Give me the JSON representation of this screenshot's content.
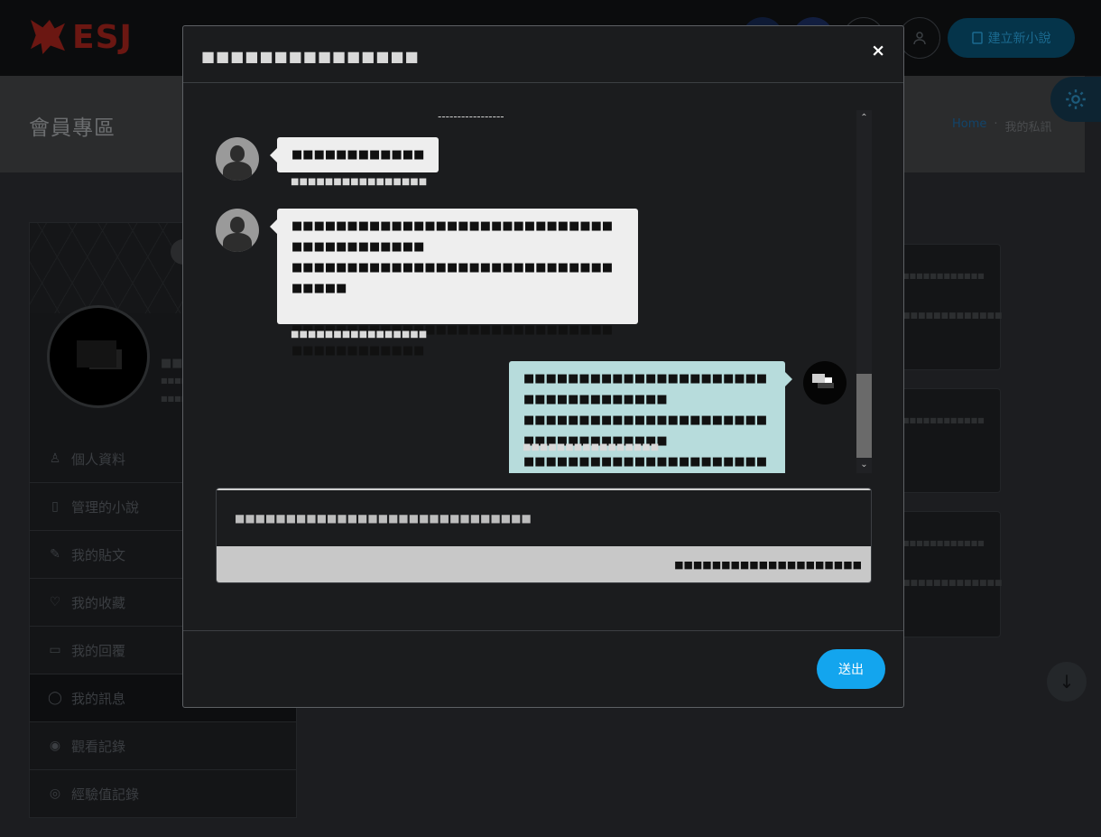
{
  "site": {
    "logo_text": "ESJ",
    "new_novel_label": "建立新小說",
    "banner_title": "會員專區",
    "breadcrumb_home": "Home",
    "breadcrumb_separator": "·",
    "breadcrumb_current": "我的私訊"
  },
  "profile": {
    "name": "■■",
    "line1": "■■■■■■■",
    "line2": "■■■■■■■"
  },
  "menu": [
    {
      "label": "個人資料",
      "icon": "user-icon",
      "glyph": "♙"
    },
    {
      "label": "管理的小說",
      "icon": "book-icon",
      "glyph": "▯"
    },
    {
      "label": "我的貼文",
      "icon": "pen-icon",
      "glyph": "✎"
    },
    {
      "label": "我的收藏",
      "icon": "heart-icon",
      "glyph": "♡"
    },
    {
      "label": "我的回覆",
      "icon": "comment-icon",
      "glyph": "▭"
    },
    {
      "label": "我的訊息",
      "icon": "message-icon",
      "glyph": "◯"
    },
    {
      "label": "觀看記錄",
      "icon": "eye-icon",
      "glyph": "◉"
    },
    {
      "label": "經驗值記錄",
      "icon": "target-icon",
      "glyph": "◎"
    }
  ],
  "right_cards": [
    {
      "line1": "■■■■■■■■■■■■",
      "line2": "■■■■■■■■■■■■■"
    },
    {
      "line1": "■■■■■■■■■■■■",
      "line2": ""
    },
    {
      "line1": "■■■■■■■■■■■■",
      "line2": "■■■■■■■■■■■■■"
    }
  ],
  "modal": {
    "title": "■■■■■■■■■■■■■■■",
    "close_label": "×",
    "divider": "-----------------",
    "messages": [
      {
        "side": "left",
        "lines": [
          "■■■■■■■■■■■■"
        ],
        "time": "■■■■■■■■■■■■■■■■"
      },
      {
        "side": "left",
        "lines": [
          "■■■■■■■■■■■■■■■■■■■■■■■■■■■■■■■■■■■■■■■■■",
          "■■■■■■■■■■■■■■■■■■■■■■■■■■■■■■■■■■",
          "",
          "■■■■■■■■■■■■■■■■■■■■■■■■■■■■■■■■■■■■■■■■■"
        ],
        "time": "■■■■■■■■■■■■■■■■"
      },
      {
        "side": "right",
        "lines": [
          "■■■■■■■■■■■■■■■■■■■■■■■■■■■■■■■■■■■",
          "■■■■■■■■■■■■■■■■■■■■■■■■■■■■■■■■■■■",
          "■■■■■■■■■■■■■■■■■■■■■■■■■■■■■■■■"
        ],
        "time": "■■■■■■■■■■■■■■■■"
      }
    ],
    "input_placeholder": "■■■■■■■■■■■■■■■■■■■■■■■■■■■■■",
    "char_count": "■■■■■■■■■■■■■■■■■■■■",
    "send_label": "送出"
  }
}
